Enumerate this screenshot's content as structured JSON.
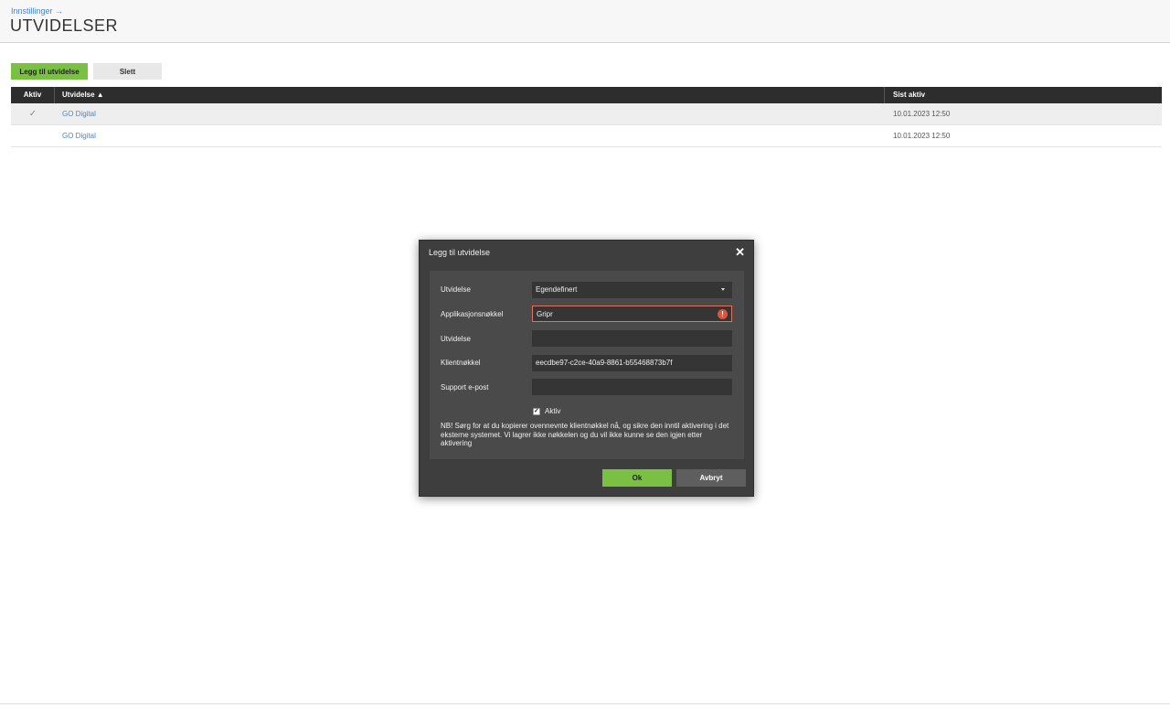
{
  "header": {
    "breadcrumb": "Innstillinger →",
    "title": "UTVIDELSER"
  },
  "toolbar": {
    "add_label": "Legg til utvidelse",
    "delete_label": "Slett"
  },
  "table": {
    "columns": {
      "active": "Aktiv",
      "extension": "Utvidelse ▲",
      "last_active": "Sist aktiv"
    },
    "rows": [
      {
        "active": "✓",
        "name": "GO Digital",
        "last_active": "10.01.2023 12:50",
        "selected": true
      },
      {
        "active": "",
        "name": "GO Digital",
        "last_active": "10.01.2023 12:50",
        "selected": false
      }
    ]
  },
  "dialog": {
    "title": "Legg til utvidelse",
    "close_icon": "close-icon",
    "fields": {
      "extension_type": {
        "label": "Utvidelse",
        "value": "Egendefinert"
      },
      "app_key": {
        "label": "Applikasjonsnøkkel",
        "value": "Gripr",
        "error": true
      },
      "extension_name": {
        "label": "Utvidelse",
        "value": ""
      },
      "client_key": {
        "label": "Klientnøkkel",
        "value": "eecdbe97-c2ce-40a9-8861-b55468873b7f"
      },
      "support_email": {
        "label": "Support e-post",
        "value": ""
      }
    },
    "active_checkbox": {
      "label": "Aktiv",
      "checked": true
    },
    "note": "NB! Sørg for at du kopierer ovennevnte klientnøkkel nå, og sikre den inntil aktivering i det eksterne systemet. Vi lagrer ikke nøkkelen og du vil ikke kunne se den igjen etter aktivering",
    "ok_label": "Ok",
    "cancel_label": "Avbryt"
  },
  "colors": {
    "accent_green": "#7ac143",
    "link_blue": "#4a86c8",
    "dialog_bg": "#3e3e3e",
    "error_red": "#d9553c"
  }
}
